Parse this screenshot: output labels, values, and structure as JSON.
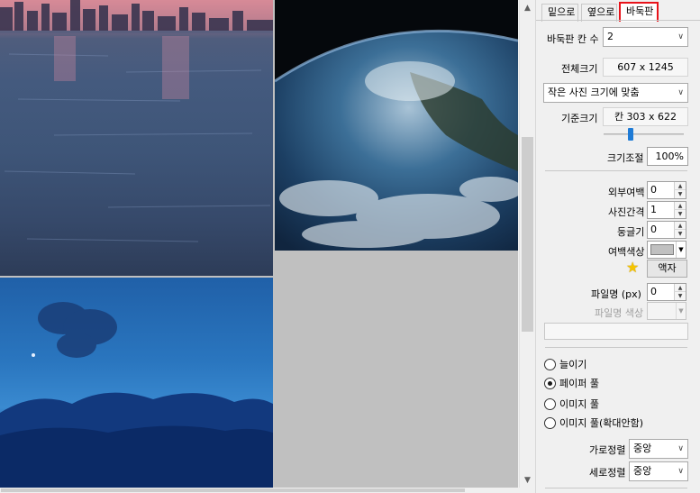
{
  "tabs": [
    "밑으로",
    "옆으로",
    "바둑판"
  ],
  "active_tab": "바둑판",
  "grid": {
    "cells_label": "바둑판 칸 수",
    "cells_value": "2",
    "total_size_label": "전체크기",
    "total_size_value": "607 x 1245",
    "fit_mode": "작은 사진 크기에 맞춤",
    "base_size_label": "기준크기",
    "base_size_value": "칸 303 x 622",
    "scale_label": "크기조절",
    "scale_value": "100%",
    "slider_fraction": 0.32
  },
  "spacing": {
    "outer_margin_label": "외부여백",
    "outer_margin_value": "0",
    "photo_gap_label": "사진간격",
    "photo_gap_value": "1",
    "rounding_label": "둥글기",
    "rounding_value": "0",
    "margin_color_label": "여백색상",
    "margin_color": "#c0c0c0",
    "frame_button": "액자",
    "filename_label": "파일명 (px)",
    "filename_value": "0",
    "filename_color_label": "파일명 색상"
  },
  "layout_options": [
    {
      "label": "늘이기",
      "checked": false
    },
    {
      "label": "페이퍼 풀",
      "checked": true
    },
    {
      "label": "이미지 풀",
      "checked": false
    },
    {
      "label": "이미지 풀(확대안함)",
      "checked": false
    }
  ],
  "alignment": {
    "horizontal_label": "가로정렬",
    "horizontal_value": "중앙",
    "vertical_label": "세로정렬",
    "vertical_value": "중앙"
  },
  "colors": {
    "accent": "#e8131a",
    "canvas_background": "#c0c0c0",
    "star": "#f5c400"
  }
}
